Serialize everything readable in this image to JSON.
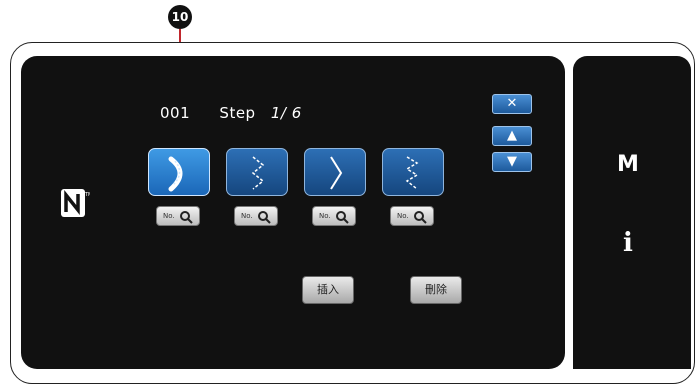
{
  "callout": {
    "number": "10"
  },
  "header": {
    "pattern_no": "001",
    "step_label": "Step",
    "step_value": "1/ 6"
  },
  "stitch_buttons": [
    {
      "icon": "curve-stitch-icon",
      "selected": true
    },
    {
      "icon": "zigzag-stitch-icon",
      "selected": false
    },
    {
      "icon": "zigzag-stitch-icon",
      "selected": false
    },
    {
      "icon": "zigzag-stitch-icon",
      "selected": false
    }
  ],
  "search_buttons": [
    {
      "label": "No."
    },
    {
      "label": "No."
    },
    {
      "label": "No."
    },
    {
      "label": "No."
    }
  ],
  "actions": {
    "insert_label": "插入",
    "delete_label": "刪除"
  },
  "nav": {
    "close": "✕",
    "up": "▲",
    "down": "▼"
  },
  "side": {
    "mode_label": "M",
    "info_label": "i"
  },
  "icons": {
    "nfc": "nfc-icon",
    "search": "search-icon"
  },
  "colors": {
    "panel": "#111111",
    "button_blue": "#1f5fa8",
    "callout_line": "#c0272d"
  }
}
